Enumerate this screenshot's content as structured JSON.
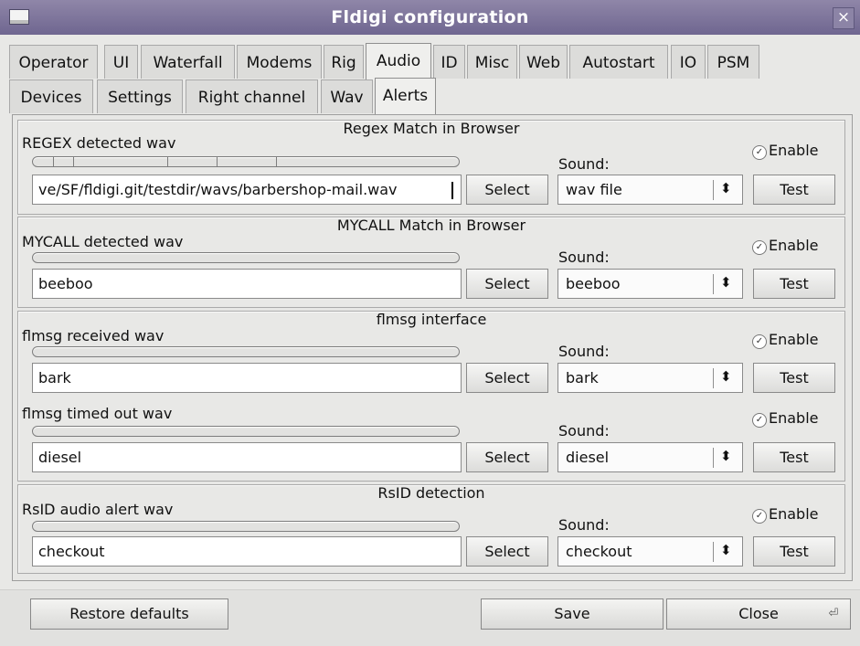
{
  "window": {
    "title": "Fldigi configuration",
    "close": "×"
  },
  "tabs_main": [
    {
      "label": "Operator"
    },
    {
      "label": "UI"
    },
    {
      "label": "Waterfall"
    },
    {
      "label": "Modems"
    },
    {
      "label": "Rig"
    },
    {
      "label": "Audio"
    },
    {
      "label": "ID"
    },
    {
      "label": "Misc"
    },
    {
      "label": "Web"
    },
    {
      "label": "Autostart"
    },
    {
      "label": "IO"
    },
    {
      "label": "PSM"
    }
  ],
  "tabs_sub": [
    {
      "label": "Devices"
    },
    {
      "label": "Settings"
    },
    {
      "label": "Right channel"
    },
    {
      "label": "Wav"
    },
    {
      "label": "Alerts"
    }
  ],
  "groups": {
    "regex": {
      "title": "Regex Match in Browser",
      "label": "REGEX detected wav",
      "file": "ve/SF/fldigi.git/testdir/wavs/barbershop-mail.wav",
      "select": "Select",
      "sound_label": "Sound:",
      "sound": "wav file",
      "enable": "Enable",
      "test": "Test"
    },
    "mycall": {
      "title": "MYCALL Match in Browser",
      "label": "MYCALL detected wav",
      "file": "beeboo",
      "select": "Select",
      "sound_label": "Sound:",
      "sound": "beeboo",
      "enable": "Enable",
      "test": "Test"
    },
    "flmsg": {
      "title": "flmsg interface",
      "received": {
        "label": "flmsg received wav",
        "file": "bark",
        "select": "Select",
        "sound_label": "Sound:",
        "sound": "bark",
        "enable": "Enable",
        "test": "Test"
      },
      "timedout": {
        "label": "flmsg timed out wav",
        "file": "diesel",
        "select": "Select",
        "sound_label": "Sound:",
        "sound": "diesel",
        "enable": "Enable",
        "test": "Test"
      }
    },
    "rsid": {
      "title": "RsID detection",
      "label": "RsID audio alert wav",
      "file": "checkout",
      "select": "Select",
      "sound_label": "Sound:",
      "sound": "checkout",
      "enable": "Enable",
      "test": "Test"
    }
  },
  "footer": {
    "restore": "Restore defaults",
    "save": "Save",
    "close": "Close"
  },
  "icons": {
    "checkbox": "checkmark-icon",
    "spinner": "updown-arrows-icon",
    "return": "return-key-icon"
  },
  "colors": {
    "titlebar": "#7a7198",
    "window_bg": "#e8e8e6"
  }
}
